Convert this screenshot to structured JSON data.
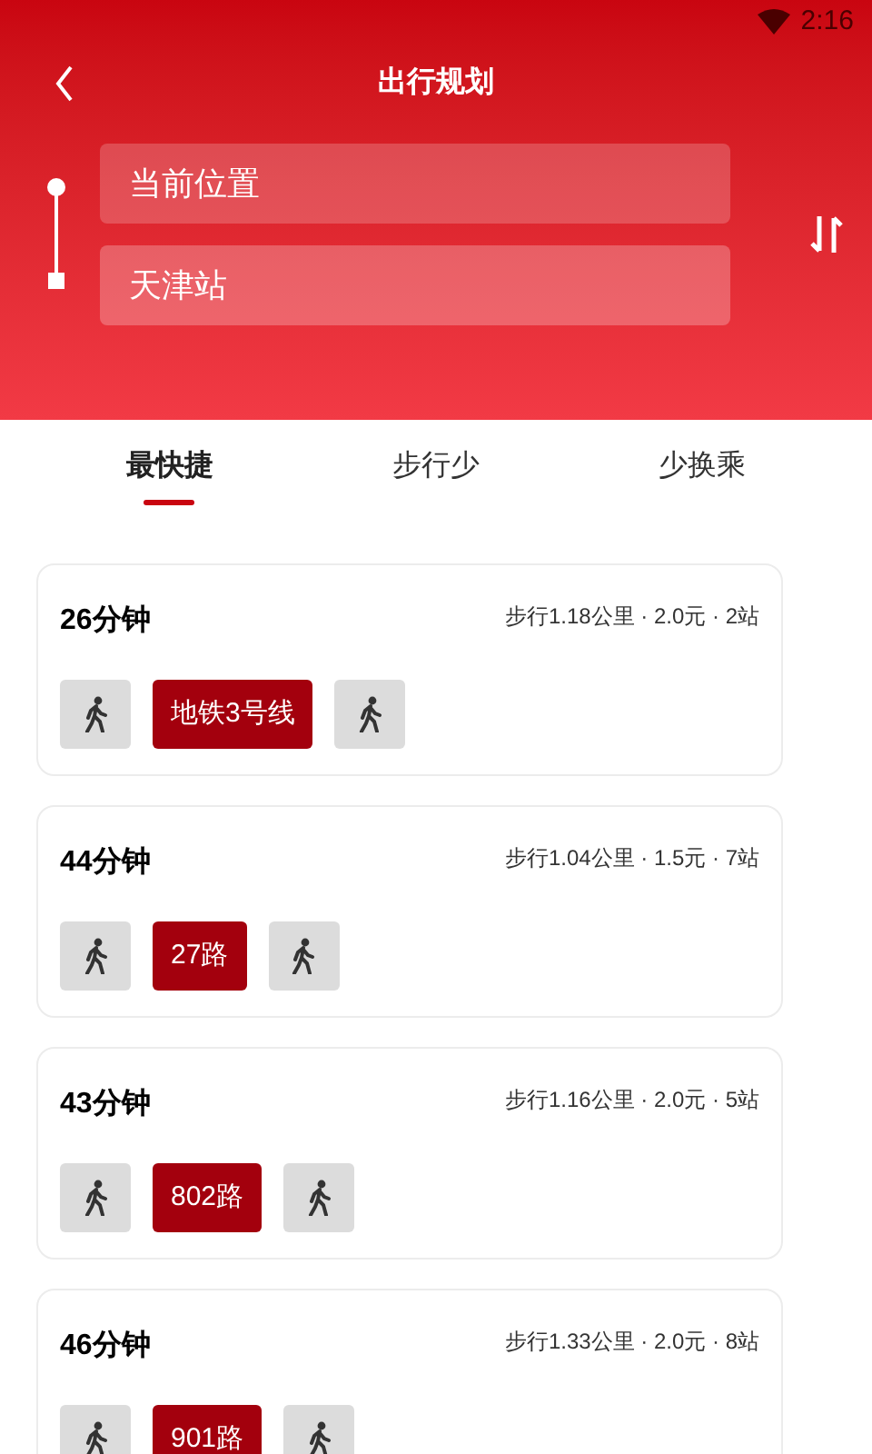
{
  "status_bar": {
    "time": "2:16"
  },
  "header": {
    "title": "出行规划"
  },
  "route": {
    "from": "当前位置",
    "to": "天津站"
  },
  "tabs": [
    {
      "label": "最快捷",
      "selected": true
    },
    {
      "label": "步行少",
      "selected": false
    },
    {
      "label": "少换乘",
      "selected": false
    }
  ],
  "plans": [
    {
      "duration": "26分钟",
      "summary": "步行1.18公里 · 2.0元 · 2站",
      "steps": [
        {
          "kind": "walk"
        },
        {
          "kind": "transit",
          "label": "地铁3号线"
        },
        {
          "kind": "walk"
        }
      ]
    },
    {
      "duration": "44分钟",
      "summary": "步行1.04公里 · 1.5元 · 7站",
      "steps": [
        {
          "kind": "walk"
        },
        {
          "kind": "transit",
          "label": "27路"
        },
        {
          "kind": "walk"
        }
      ]
    },
    {
      "duration": "43分钟",
      "summary": "步行1.16公里 · 2.0元 · 5站",
      "steps": [
        {
          "kind": "walk"
        },
        {
          "kind": "transit",
          "label": "802路"
        },
        {
          "kind": "walk"
        }
      ]
    },
    {
      "duration": "46分钟",
      "summary": "步行1.33公里 · 2.0元 · 8站",
      "steps": [
        {
          "kind": "walk"
        },
        {
          "kind": "transit",
          "label": "901路"
        },
        {
          "kind": "walk"
        }
      ]
    }
  ]
}
